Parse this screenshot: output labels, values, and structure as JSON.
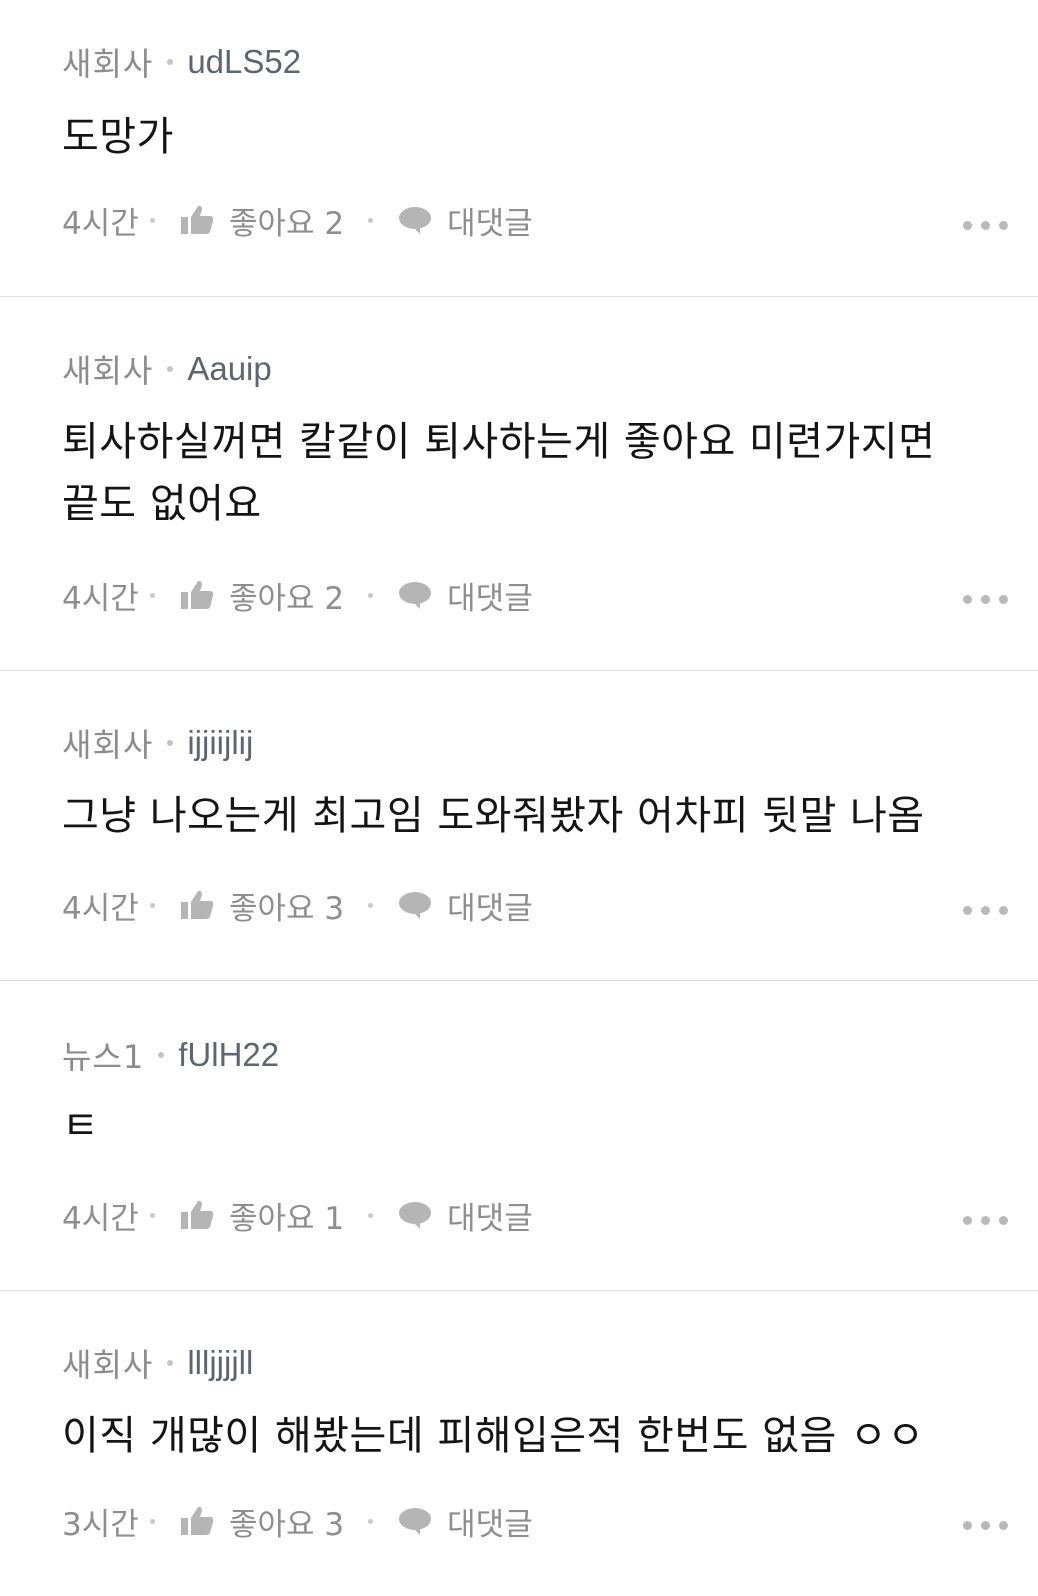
{
  "comments": [
    {
      "source": "새회사",
      "author": "udLS52",
      "text": "도망가",
      "time": "4시간",
      "like_label": "좋아요",
      "like_count": "2",
      "reply_label": "대댓글"
    },
    {
      "source": "새회사",
      "author": "Aauip",
      "text": "퇴사하실꺼면 칼같이 퇴사하는게 좋아요 미련가지면 끝도 없어요",
      "time": "4시간",
      "like_label": "좋아요",
      "like_count": "2",
      "reply_label": "대댓글"
    },
    {
      "source": "새회사",
      "author": "ijjiijlij",
      "text": "그냥 나오는게 최고임 도와줘봤자 어차피 뒷말 나옴",
      "time": "4시간",
      "like_label": "좋아요",
      "like_count": "3",
      "reply_label": "대댓글"
    },
    {
      "source": "뉴스1",
      "author": "fUlH22",
      "text": "ㅌ",
      "time": "4시간",
      "like_label": "좋아요",
      "like_count": "1",
      "reply_label": "대댓글"
    },
    {
      "source": "새회사",
      "author": "llljjjjll",
      "text": "이직 개많이 해봤는데 피해입은적 한번도 없음 ㅇㅇ",
      "time": "3시간",
      "like_label": "좋아요",
      "like_count": "3",
      "reply_label": "대댓글"
    }
  ],
  "icons": {
    "like": "thumbs-up-icon",
    "reply": "speech-bubble-icon",
    "more": "more-dots-icon"
  },
  "colors": {
    "meta_text": "#8c8c8c",
    "author_text": "#5e6571",
    "body_text": "#141414",
    "divider": "#dedede",
    "icon": "#b5b5b5"
  }
}
